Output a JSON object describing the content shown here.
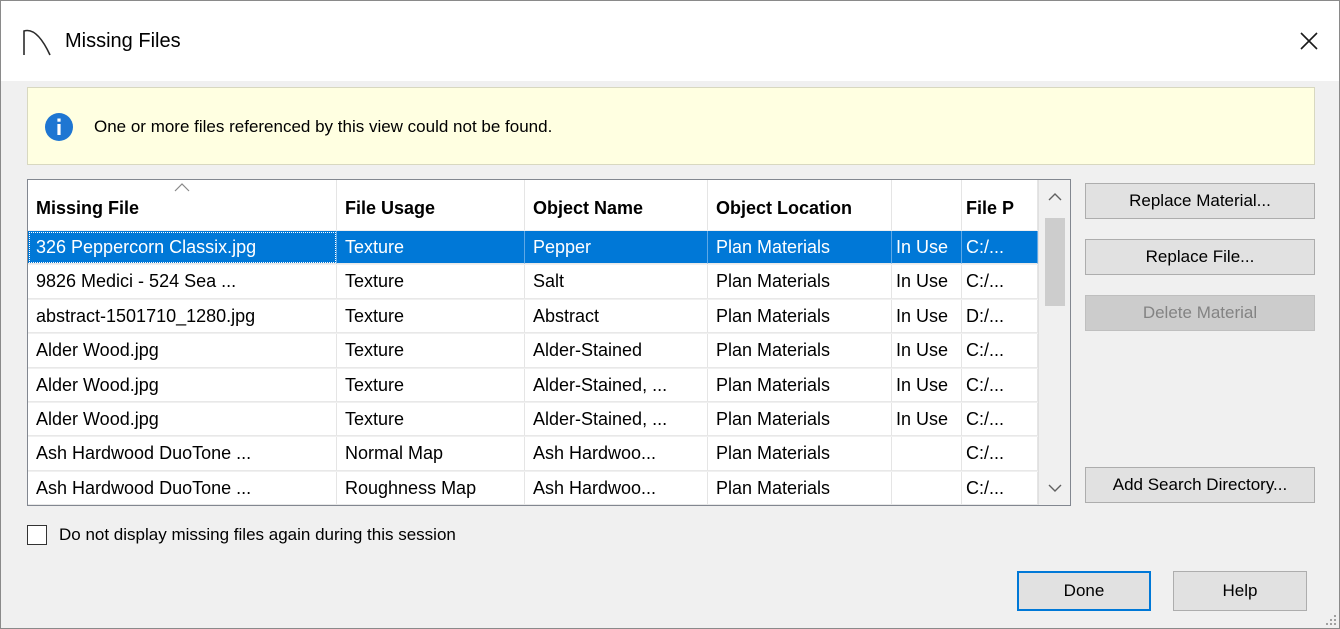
{
  "window": {
    "title": "Missing Files",
    "close_glyph": "✕"
  },
  "info": {
    "message": "One or more files referenced by this view could not be found.",
    "icon": "info-icon",
    "icon_color": "#1e76d2"
  },
  "table": {
    "columns": [
      "Missing File",
      "File Usage",
      "Object Name",
      "Object Location",
      "",
      "File P"
    ],
    "sorted_column": 0,
    "selected_row": 0,
    "rows": [
      [
        "326 Peppercorn Classix.jpg",
        "Texture",
        "Pepper",
        "Plan Materials",
        "In Use",
        "C:/..."
      ],
      [
        "9826 Medici - 524 Sea ...",
        "Texture",
        "Salt",
        "Plan Materials",
        "In Use",
        "C:/..."
      ],
      [
        "abstract-1501710_1280.jpg",
        "Texture",
        "Abstract",
        "Plan Materials",
        "In Use",
        "D:/..."
      ],
      [
        "Alder Wood.jpg",
        "Texture",
        "Alder-Stained",
        "Plan Materials",
        "In Use",
        "C:/..."
      ],
      [
        "Alder Wood.jpg",
        "Texture",
        "Alder-Stained, ...",
        "Plan Materials",
        "In Use",
        "C:/..."
      ],
      [
        "Alder Wood.jpg",
        "Texture",
        "Alder-Stained, ...",
        "Plan Materials",
        "In Use",
        "C:/..."
      ],
      [
        "Ash Hardwood DuoTone ...",
        "Normal Map",
        "Ash Hardwoo...",
        "Plan Materials",
        "",
        "C:/..."
      ],
      [
        "Ash Hardwood DuoTone ...",
        "Roughness Map",
        "Ash Hardwoo...",
        "Plan Materials",
        "",
        "C:/..."
      ]
    ]
  },
  "side_buttons": {
    "replace_material": "Replace Material...",
    "replace_file": "Replace File...",
    "delete_material": "Delete Material",
    "add_search_directory": "Add Search Directory..."
  },
  "checkbox": {
    "label": "Do not display missing files again during this session",
    "checked": false
  },
  "footer": {
    "done": "Done",
    "help": "Help"
  },
  "colors": {
    "selection": "#0078d7",
    "info_background": "#ffffe1",
    "dialog_background": "#f0f0f0"
  }
}
